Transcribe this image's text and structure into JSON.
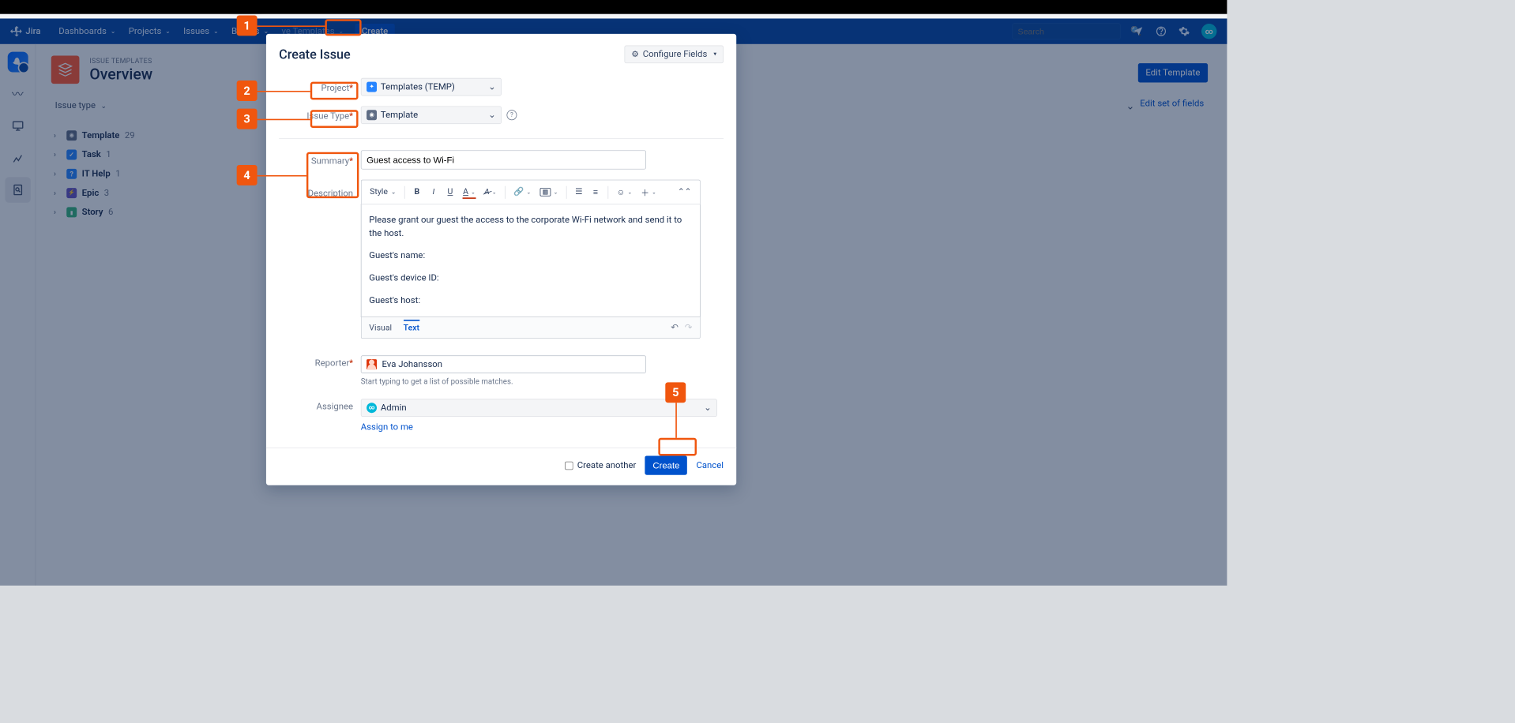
{
  "brand": "Jira",
  "nav": {
    "items": [
      {
        "label": "Dashboards"
      },
      {
        "label": "Projects"
      },
      {
        "label": "Issues"
      },
      {
        "label": "Boards"
      },
      {
        "label": "ve Templates"
      }
    ],
    "create": "Create",
    "search_placeholder": "Search"
  },
  "sidebar": {
    "breadcrumb": "ISSUE TEMPLATES",
    "title": "Overview",
    "edit_template": "Edit Template",
    "edit_set": "Edit set of fields",
    "issue_type_label": "Issue type",
    "tree": [
      {
        "label": "Template",
        "count": "29",
        "icon": "template"
      },
      {
        "label": "Task",
        "count": "1",
        "icon": "task"
      },
      {
        "label": "IT Help",
        "count": "1",
        "icon": "help"
      },
      {
        "label": "Epic",
        "count": "3",
        "icon": "epic"
      },
      {
        "label": "Story",
        "count": "6",
        "icon": "story"
      }
    ]
  },
  "modal": {
    "title": "Create Issue",
    "configure": "Configure Fields",
    "labels": {
      "project": "Project",
      "issue_type": "Issue Type",
      "summary": "Summary",
      "description": "Description",
      "reporter": "Reporter",
      "assignee": "Assignee"
    },
    "values": {
      "project": "Templates (TEMP)",
      "issue_type": "Template",
      "summary": "Guest access to Wi-Fi",
      "reporter": "Eva Johansson",
      "assignee": "Admin"
    },
    "description_lines": [
      "Please grant our guest the access to the corporate Wi-Fi network and send it to the host.",
      "Guest's name:",
      "Guest's device ID:",
      "Guest's host:"
    ],
    "reporter_hint": "Start typing to get a list of possible matches.",
    "assign_to_me": "Assign to me",
    "toolbar_style": "Style",
    "tabs": {
      "visual": "Visual",
      "text": "Text"
    },
    "create_another": "Create another",
    "create": "Create",
    "cancel": "Cancel"
  },
  "annotations": [
    "1",
    "2",
    "3",
    "4",
    "5"
  ]
}
